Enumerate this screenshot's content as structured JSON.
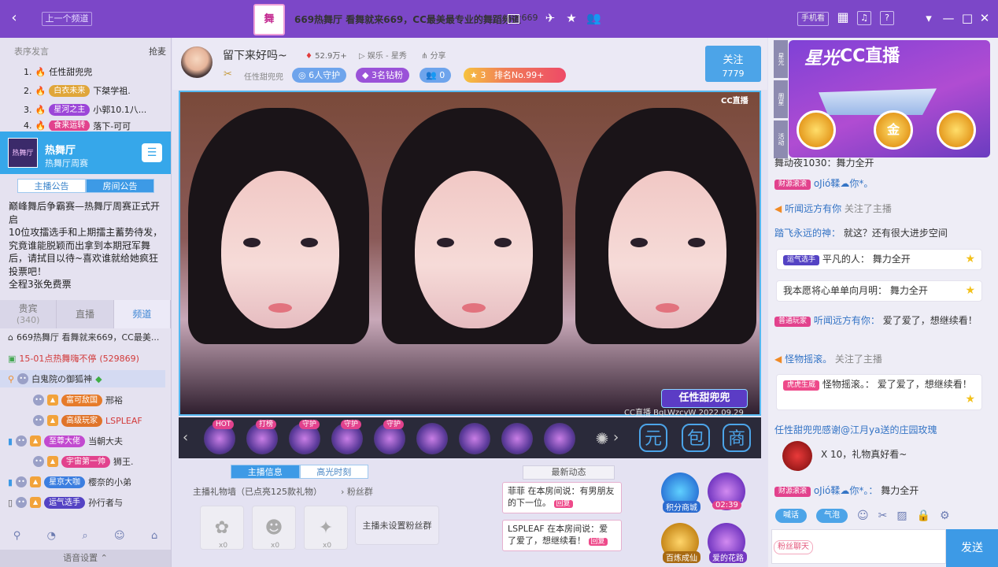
{
  "titlebar": {
    "prev_channel": "上一个频道",
    "logo_text": "舞",
    "title": "669热舞厅 看舞就来669，CC最美最专业的舞蹈频道",
    "id_label": "ID",
    "room_id": "669",
    "mobile_view": "手机看",
    "help": "?"
  },
  "ranking": {
    "header": "表序发言",
    "grab": "抢麦",
    "items": [
      {
        "num": "1.",
        "name": "任性甜兜兜",
        "badge": "",
        "badge_color": ""
      },
      {
        "num": "2.",
        "name": "下桀学祖.",
        "badge": "白衣未来",
        "badge_color": "#e0a63a"
      },
      {
        "num": "3.",
        "name": "小郭10.1八...",
        "badge": "星河之主",
        "badge_color": "#9c46d8"
      },
      {
        "num": "4.",
        "name": "落下-可可",
        "badge": "食来运转",
        "badge_color": "#e2428d"
      }
    ]
  },
  "channel": {
    "img_text": "热舞厅",
    "name": "热舞厅",
    "sub": "热舞厅周赛",
    "tab_anchor": "主播公告",
    "tab_room": "房间公告",
    "announcement": "巅峰舞后争霸赛—热舞厅周赛正式开启\n10位攻擂选手和上期擂主蓄势待发，究竟谁能脱颖而出拿到本期冠军舞后，请拭目以待~喜欢谁就给她疯狂投票吧！\n全程3张免费票"
  },
  "left_tabs": {
    "audience": "贵宾",
    "audience_count": "(340)",
    "live": "直播",
    "channel": "频道"
  },
  "channel_list": {
    "line1": "669热舞厅 看舞就来669，CC最美...",
    "line2": "15-01点热舞嗨不停",
    "line2_count": "(529869)",
    "users": [
      {
        "name": "白鬼院の御狐神",
        "pill": "",
        "pill_color": ""
      },
      {
        "name": "邢裕",
        "pill": "富可敌国",
        "pill_color": "#e67b2a"
      },
      {
        "name": "LSPLEAF",
        "pill": "高级玩家",
        "pill_color": "#e0742a"
      },
      {
        "name": "当朝大夫",
        "pill": "至尊大佬",
        "pill_color": "#c24ad0"
      },
      {
        "name": "狮王.",
        "pill": "宇宙第一帅",
        "pill_color": "#e2428d"
      },
      {
        "name": "樱奈的小弟",
        "pill": "星京大咖",
        "pill_color": "#3c7ee0"
      },
      {
        "name": "孙行者与",
        "pill": "运气选手",
        "pill_color": "#5443c4"
      }
    ]
  },
  "left_footer": {
    "voice_settings": "语音设置"
  },
  "anchor": {
    "name": "留下来好吗~",
    "hot": "52.9万+",
    "category": "娱乐 - 星秀",
    "share": "分享",
    "host_name": "任性甜兜兜",
    "guard": "6人守护",
    "diamond": "3名钻粉",
    "fans": "0",
    "rank_level": "3",
    "rank": "排名No.99+",
    "follow_label": "关注",
    "follow_count": "7779"
  },
  "video": {
    "cc_logo": "CC直播",
    "anchor_tag": "任性甜兜兜",
    "watermark": "CC直播 BgLWzcyW 2022.09.29"
  },
  "gifts": {
    "tags": [
      "HOT",
      "打榜",
      "守护",
      "守护",
      "守护"
    ],
    "btn_1": "元",
    "btn_2": "包",
    "btn_3": "商"
  },
  "info": {
    "tab_info": "主播信息",
    "tab_highlight": "高光时刻",
    "gift_wall": "主播礼物墙（已点亮125款礼物）",
    "fan_group": "粉丝群",
    "no_fan_group": "主播未设置粉丝群",
    "wall_x": [
      "x0",
      "x0",
      "x0"
    ]
  },
  "news": {
    "title": "最新动态",
    "items": [
      {
        "text": "菲菲 在本房间说：有男朋友的下一位。",
        "reply": "回复"
      },
      {
        "text": "LSPLEAF 在本房间说：爱了爱了，想继续看！",
        "reply": "回复"
      }
    ]
  },
  "shops": {
    "points": "积分商城",
    "timer": "02:39",
    "ascend": "百炼成仙",
    "flower": "爱的花路"
  },
  "banner": {
    "title": "星光",
    "brand": "CC直播",
    "coin_text": "金",
    "strips": [
      "星光",
      "周星",
      "活动"
    ]
  },
  "chat": {
    "l1": "舞动夜1030：舞力全开",
    "l2_badge": "财源滚滚",
    "l2": "oJió鞣☁你*。",
    "l3_name": "听闻远方有你",
    "l3_sys": "关注了主播",
    "l4_name": "踏飞永远的神：",
    "l4": "就这？还有很大进步空间",
    "card1_badge": "运气选手",
    "card1_name": "平凡的人：",
    "card1": "舞力全开",
    "card2_name": "我本愿将心单单向月明：",
    "card2": "舞力全开",
    "l5_badge": "普通玩家",
    "l5_name": "听闻远方有你：",
    "l5": "爱了爱了，想继续看！",
    "l6_name": "怪物摇滚。",
    "l6_sys": "关注了主播",
    "card3_badge": "虎虎生威",
    "card3_name": "怪物摇滚。：",
    "card3": "爱了爱了，想继续看！",
    "thanks": "任性甜兜兜感谢@江月ya送的庄园玫瑰",
    "rose_count": "X 10，礼物真好看~",
    "l7_badge": "财源滚滚",
    "l7_name": "oJió鞣☁你*。：",
    "l7": "舞力全开"
  },
  "chat_tools": {
    "b1": "喊话",
    "b2": "气泡",
    "fans_btn": "粉丝聊天",
    "send": "发送"
  }
}
